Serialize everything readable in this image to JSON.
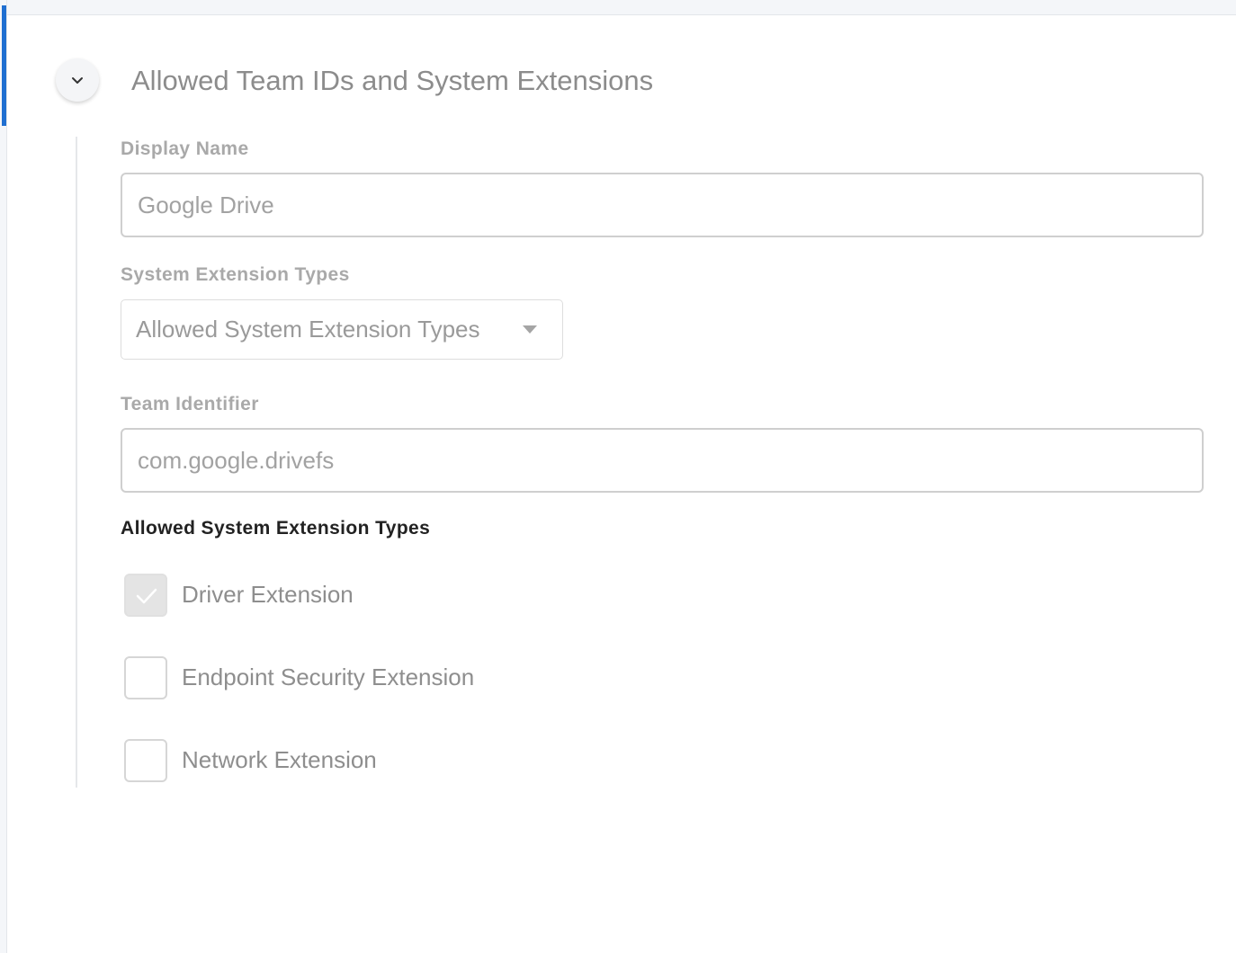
{
  "section": {
    "title": "Allowed Team IDs and System Extensions",
    "expanded": true
  },
  "display_name": {
    "label": "Display Name",
    "value": "Google Drive"
  },
  "extension_types": {
    "label": "System Extension Types",
    "selected": "Allowed System Extension Types"
  },
  "team_identifier": {
    "label": "Team Identifier",
    "value": "com.google.drivefs"
  },
  "allowed_types": {
    "heading": "Allowed System Extension Types",
    "options": [
      {
        "label": "Driver Extension",
        "checked": true
      },
      {
        "label": "Endpoint Security Extension",
        "checked": false
      },
      {
        "label": "Network Extension",
        "checked": false
      }
    ]
  },
  "colors": {
    "accent": "#1f6fd1",
    "heading": "#222222",
    "muted_text": "#8c8c8c"
  },
  "icons": {
    "collapse": "chevron-down-icon",
    "select_caret": "caret-down-icon",
    "checked": "check-icon"
  }
}
